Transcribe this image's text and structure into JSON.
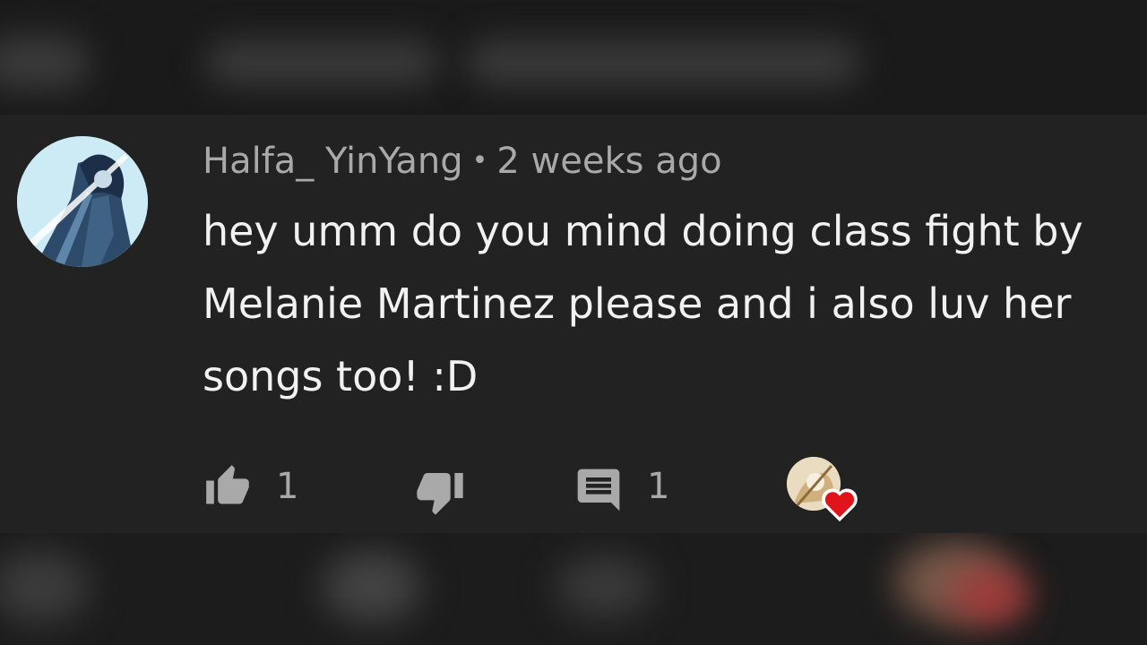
{
  "comment": {
    "author": "Halfa_ YinYang",
    "separator": "•",
    "time": "2 weeks ago",
    "lines": [
      "hey umm do you mind doing class fight by",
      "Melanie Martinez please and i also luv her",
      "songs too! :D"
    ]
  },
  "actions": {
    "like_count": "1",
    "reply_count": "1"
  },
  "icons": {
    "like": "thumbs-up-icon",
    "dislike": "thumbs-down-icon",
    "reply": "comment-icon",
    "creator_heart": "heart-icon"
  },
  "colors": {
    "background": "#222222",
    "meta_text": "#a9a9a9",
    "body_text": "#f1f1f1",
    "heart": "#e1141b"
  }
}
